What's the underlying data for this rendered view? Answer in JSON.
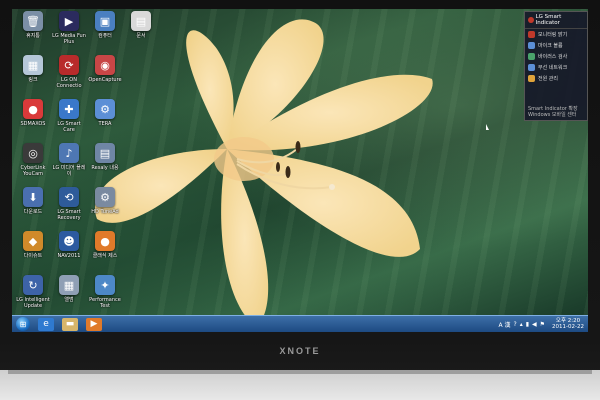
{
  "desktop": {
    "icons": [
      {
        "label": "휴지통",
        "color": "#7b8fa6",
        "glyph": "🗑"
      },
      {
        "label": "LG Media Fun Plus",
        "color": "#2b2b5e",
        "glyph": "▶"
      },
      {
        "label": "컴퓨터",
        "color": "#4a7fc0",
        "glyph": "▣"
      },
      {
        "label": "문서",
        "color": "#d9d9d9",
        "glyph": "▤"
      },
      {
        "label": "링크",
        "color": "#b5c7d8",
        "glyph": "▦"
      },
      {
        "label": "LG ON Connectio",
        "color": "#b82b2b",
        "glyph": "⟳"
      },
      {
        "label": "OpenCapture",
        "color": "#c84646",
        "glyph": "◉"
      },
      {
        "label": "SDMAXOS",
        "color": "#d93a3a",
        "glyph": "●"
      },
      {
        "label": "LG Smart Care",
        "color": "#3a78c9",
        "glyph": "✚"
      },
      {
        "label": "TERA",
        "color": "#5c8fd6",
        "glyph": "⚙"
      },
      {
        "label": "CyberLink YouCam",
        "color": "#3a3a3a",
        "glyph": "◎"
      },
      {
        "label": "LG 미디어 플레이",
        "color": "#4e77b3",
        "glyph": "♪"
      },
      {
        "label": "Resaly 내용",
        "color": "#6f86a5",
        "glyph": "▤"
      },
      {
        "label": "다운로드",
        "color": "#4a6fb0",
        "glyph": "⬇"
      },
      {
        "label": "LG Smart Recovery",
        "color": "#2e5b9a",
        "glyph": "⟲"
      },
      {
        "label": "HD TuneAd",
        "color": "#7a8aa0",
        "glyph": "⚙"
      },
      {
        "label": "다이슈트",
        "color": "#d08a2a",
        "glyph": "◆"
      },
      {
        "label": "NAV2011",
        "color": "#2c5aa0",
        "glyph": "☻"
      },
      {
        "label": "클래식 제스",
        "color": "#e07a2a",
        "glyph": "●"
      },
      {
        "label": "LG Intelligent Update",
        "color": "#3d63a8",
        "glyph": "↻"
      },
      {
        "label": "앨범",
        "color": "#8f9fb5",
        "glyph": "▦"
      },
      {
        "label": "Performance Test",
        "color": "#4d88c7",
        "glyph": "✦"
      }
    ]
  },
  "gadget": {
    "title": "LG Smart Indicator",
    "items": [
      {
        "label": "모니터링 밝기",
        "color": "#c0392b"
      },
      {
        "label": "마이크 볼륨",
        "color": "#5c8fd6"
      },
      {
        "label": "바이러스 검사",
        "color": "#4aa36b"
      },
      {
        "label": "무선 네트워크",
        "color": "#5c8fd6"
      },
      {
        "label": "전원 관리",
        "color": "#e0a33a"
      }
    ],
    "footer_1": "Smart Indicator 확장",
    "footer_2": "Windows 모바일 센터"
  },
  "taskbar": {
    "start_glyph": "⊞",
    "pinned": [
      {
        "name": "ie",
        "glyph": "e",
        "color": "#2f7ad0"
      },
      {
        "name": "explorer",
        "glyph": "▬",
        "color": "#d7b56a"
      },
      {
        "name": "media-player",
        "glyph": "▶",
        "color": "#e07a2a"
      }
    ],
    "tray_lang": "A 漢",
    "time": "오후 2:20",
    "date": "2011-02-22"
  },
  "bezel": {
    "brand": "XNOTE"
  }
}
